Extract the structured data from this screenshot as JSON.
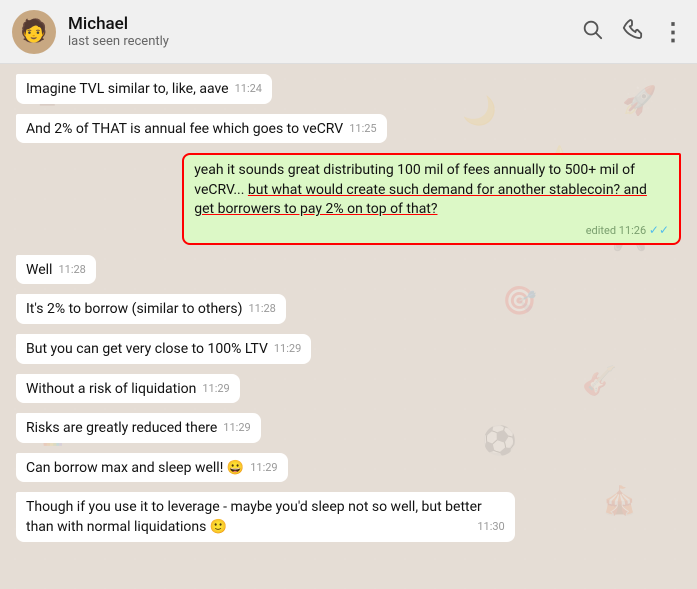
{
  "header": {
    "name": "Michael",
    "status": "last seen recently",
    "avatar_emoji": "👩",
    "search_icon": "🔍",
    "phone_icon": "📞",
    "more_icon": "⋮"
  },
  "messages": [
    {
      "id": "msg1",
      "type": "received",
      "text": "Imagine TVL similar to, like, aave",
      "time": "11:24",
      "highlighted": false
    },
    {
      "id": "msg2",
      "type": "received",
      "text": "And 2% of THAT is annual fee which goes to veCRV",
      "time": "11:25",
      "highlighted": false
    },
    {
      "id": "msg3",
      "type": "sent",
      "text": "yeah it sounds great distributing 100 mil of fees annually to 500+ mil of veCRV... but what would create such demand for another stablecoin? and get borrowers to pay 2% on top of that?",
      "time": "edited 11:26",
      "highlighted": true,
      "double_check": true
    },
    {
      "id": "msg4",
      "type": "received",
      "text": "Well",
      "time": "11:28",
      "highlighted": false
    },
    {
      "id": "msg5",
      "type": "received",
      "text": "It's 2% to borrow (similar to others)",
      "time": "11:28",
      "highlighted": false
    },
    {
      "id": "msg6",
      "type": "received",
      "text": "But you can get very close to 100% LTV",
      "time": "11:29",
      "highlighted": false
    },
    {
      "id": "msg7",
      "type": "received",
      "text": "Without a risk of liquidation",
      "time": "11:29",
      "highlighted": false
    },
    {
      "id": "msg8",
      "type": "received",
      "text": "Risks are greatly reduced there",
      "time": "11:29",
      "highlighted": false
    },
    {
      "id": "msg9",
      "type": "received",
      "text": "Can borrow max and sleep well! 😀",
      "time": "11:29",
      "highlighted": false
    },
    {
      "id": "msg10",
      "type": "received",
      "text": "Though if you use it to leverage - maybe you'd sleep not so well, but better than with normal liquidations 🙂",
      "time": "11:30",
      "highlighted": false
    }
  ]
}
